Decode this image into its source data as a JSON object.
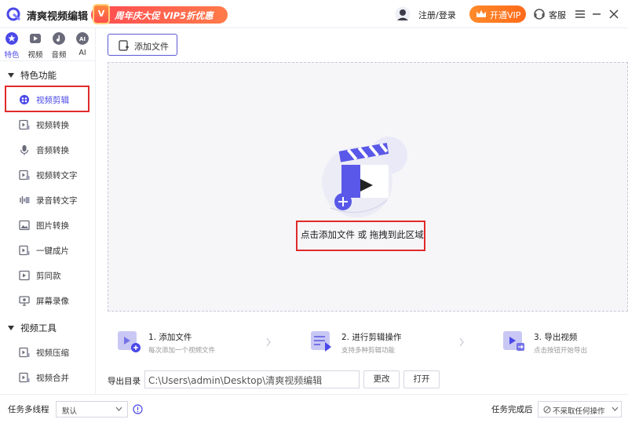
{
  "app": {
    "title": "清爽视频编辑"
  },
  "promo": {
    "badge": "V",
    "text": "周年庆大促 VIP5折优惠"
  },
  "header": {
    "login": "注册/登录",
    "vip": "开通VIP",
    "service": "客服"
  },
  "topnav": [
    {
      "label": "特色",
      "icon": "star-icon"
    },
    {
      "label": "视频",
      "icon": "video-icon"
    },
    {
      "label": "音频",
      "icon": "audio-icon"
    },
    {
      "label": "AI",
      "icon": "ai-icon"
    }
  ],
  "sidebar": {
    "section1": "特色功能",
    "section2": "视频工具",
    "items": [
      {
        "label": "视频剪辑",
        "icon": "film-edit-icon"
      },
      {
        "label": "视频转换",
        "icon": "video-convert-icon"
      },
      {
        "label": "音频转换",
        "icon": "microphone-icon"
      },
      {
        "label": "视频转文字",
        "icon": "video-to-text-icon"
      },
      {
        "label": "录音转文字",
        "icon": "audio-to-text-icon"
      },
      {
        "label": "图片转换",
        "icon": "image-icon"
      },
      {
        "label": "一键成片",
        "icon": "one-click-video-icon"
      },
      {
        "label": "剪同款",
        "icon": "template-icon"
      },
      {
        "label": "屏幕录像",
        "icon": "screen-record-icon"
      }
    ],
    "tools": [
      {
        "label": "视频压缩",
        "icon": "compress-icon"
      },
      {
        "label": "视频合并",
        "icon": "merge-icon"
      }
    ]
  },
  "main": {
    "add_file": "添加文件",
    "drop_text": "点击添加文件 或 拖拽到此区域",
    "steps": [
      {
        "title": "1. 添加文件",
        "sub": "每次添加一个视频文件"
      },
      {
        "title": "2. 进行剪辑操作",
        "sub": "支持多种剪辑功能"
      },
      {
        "title": "3. 导出视频",
        "sub": "点击按钮开始导出"
      }
    ],
    "export": {
      "label": "导出目录",
      "path": "C:\\Users\\admin\\Desktop\\清爽视频编辑",
      "change": "更改",
      "open": "打开"
    }
  },
  "bottom": {
    "threads_label": "任务多线程",
    "threads_value": "默认",
    "after_label": "任务完成后",
    "after_value": "不采取任何操作"
  },
  "colors": {
    "accent": "#4a48e8",
    "highlight_box": "#e02a2a",
    "vip": "#ff7a22"
  }
}
